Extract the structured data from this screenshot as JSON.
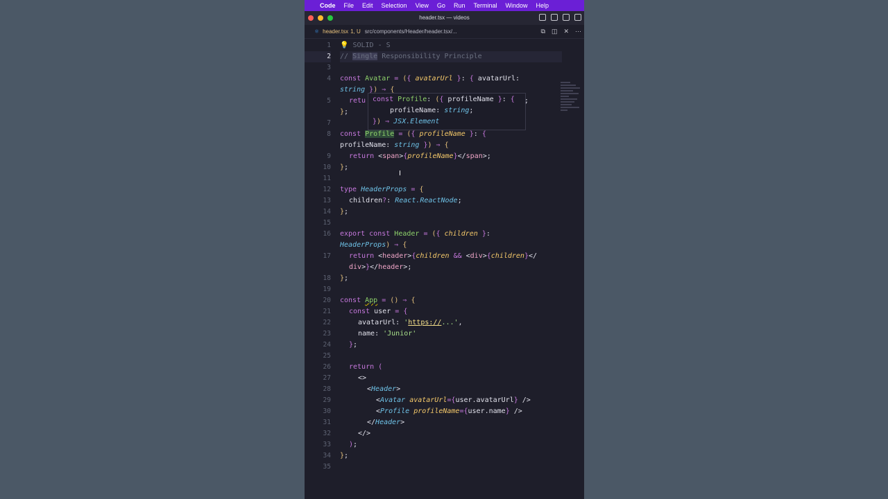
{
  "menubar": {
    "app_name": "Code",
    "items": [
      "File",
      "Edit",
      "Selection",
      "View",
      "Go",
      "Run",
      "Terminal",
      "Window",
      "Help"
    ]
  },
  "window": {
    "title": "header.tsx — videos"
  },
  "tab": {
    "name": "header.tsx",
    "badge": "1, U",
    "path": "src/components/Header/header.tsx/..."
  },
  "editor": {
    "line_numbers": [
      "1",
      "2",
      "3",
      "4",
      "",
      "5",
      "",
      "7",
      "8",
      "",
      "9",
      "10",
      "11",
      "12",
      "13",
      "14",
      "15",
      "16",
      "",
      "17",
      "",
      "18",
      "19",
      "20",
      "21",
      "22",
      "23",
      "24",
      "25",
      "26",
      "27",
      "28",
      "29",
      "30",
      "31",
      "32",
      "33",
      "34",
      "35"
    ],
    "active_line": 2
  },
  "hover": {
    "lines": [
      "const Profile: ({ profileName }: {",
      "profileName: string;",
      "}) ⇒ JSX.Element"
    ]
  },
  "colors": {
    "menubar": "#6b1fd6",
    "editor_bg": "#1e1e2a",
    "keyword": "#c678dd",
    "function": "#8fd36b",
    "type": "#6fc3e8"
  }
}
